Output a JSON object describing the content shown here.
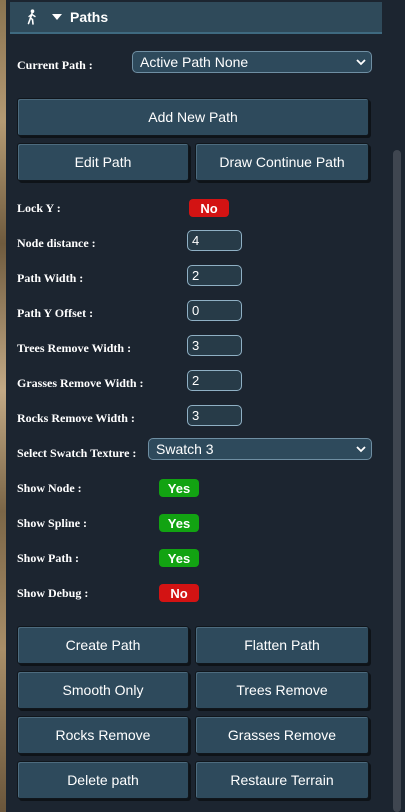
{
  "header": {
    "title": "Paths",
    "icon": "walking-person-icon"
  },
  "current_path": {
    "label": "Current Path :",
    "selected": "Active Path None"
  },
  "buttons": {
    "add_new_path": "Add New Path",
    "edit_path": "Edit Path",
    "draw_continue_path": "Draw Continue Path"
  },
  "lock_y": {
    "label": "Lock Y :",
    "value": "No"
  },
  "fields": {
    "node_distance": {
      "label": "Node distance :",
      "value": "4"
    },
    "path_width": {
      "label": "Path Width :",
      "value": "2"
    },
    "path_y_offset": {
      "label": "Path Y Offset :",
      "value": "0"
    },
    "trees_remove_width": {
      "label": "Trees Remove Width :",
      "value": "3"
    },
    "grasses_remove_width": {
      "label": "Grasses Remove Width :",
      "value": "2"
    },
    "rocks_remove_width": {
      "label": "Rocks Remove Width :",
      "value": "3"
    }
  },
  "swatch": {
    "label": "Select Swatch Texture :",
    "selected": "Swatch 3"
  },
  "toggles": {
    "show_node": {
      "label": "Show Node :",
      "value": "Yes"
    },
    "show_spline": {
      "label": "Show Spline :",
      "value": "Yes"
    },
    "show_path": {
      "label": "Show Path :",
      "value": "Yes"
    },
    "show_debug": {
      "label": "Show Debug :",
      "value": "No"
    }
  },
  "actions": {
    "create_path": "Create Path",
    "flatten_path": "Flatten Path",
    "smooth_only": "Smooth Only",
    "trees_remove": "Trees Remove",
    "rocks_remove": "Rocks Remove",
    "grasses_remove": "Grasses Remove",
    "delete_path": "Delete path",
    "restaure_terrain": "Restaure Terrain"
  },
  "colors": {
    "panel_bg": "#1c2530",
    "button_bg": "#2e4a5c",
    "header_bg": "#2f4a5a",
    "yes": "#12a312",
    "no": "#d31313"
  }
}
